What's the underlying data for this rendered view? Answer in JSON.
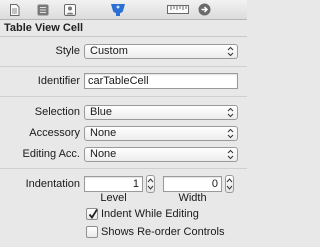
{
  "tabs": [
    {
      "icon": "file-icon"
    },
    {
      "icon": "quick-help-icon"
    },
    {
      "icon": "identity-icon"
    },
    {
      "icon": "attributes-icon",
      "selected": true
    },
    {
      "icon": "size-ruler-icon"
    },
    {
      "icon": "connections-arrow-icon"
    }
  ],
  "section": {
    "title": "Table View Cell"
  },
  "style": {
    "label": "Style",
    "value": "Custom"
  },
  "identifier": {
    "label": "Identifier",
    "value": "carTableCell"
  },
  "selection": {
    "label": "Selection",
    "value": "Blue"
  },
  "accessory": {
    "label": "Accessory",
    "value": "None"
  },
  "editing_accessory": {
    "label": "Editing Acc.",
    "value": "None"
  },
  "indentation": {
    "label": "Indentation",
    "level": {
      "value": "1",
      "caption": "Level"
    },
    "width": {
      "value": "0",
      "caption": "Width"
    }
  },
  "indent_while_editing": {
    "label": "Indent While Editing",
    "checked": true
  },
  "shows_reorder_controls": {
    "label": "Shows Re-order Controls",
    "checked": false
  },
  "colors": {
    "selected_tab": "#2a6fd1",
    "background": "#e8e8e8"
  }
}
